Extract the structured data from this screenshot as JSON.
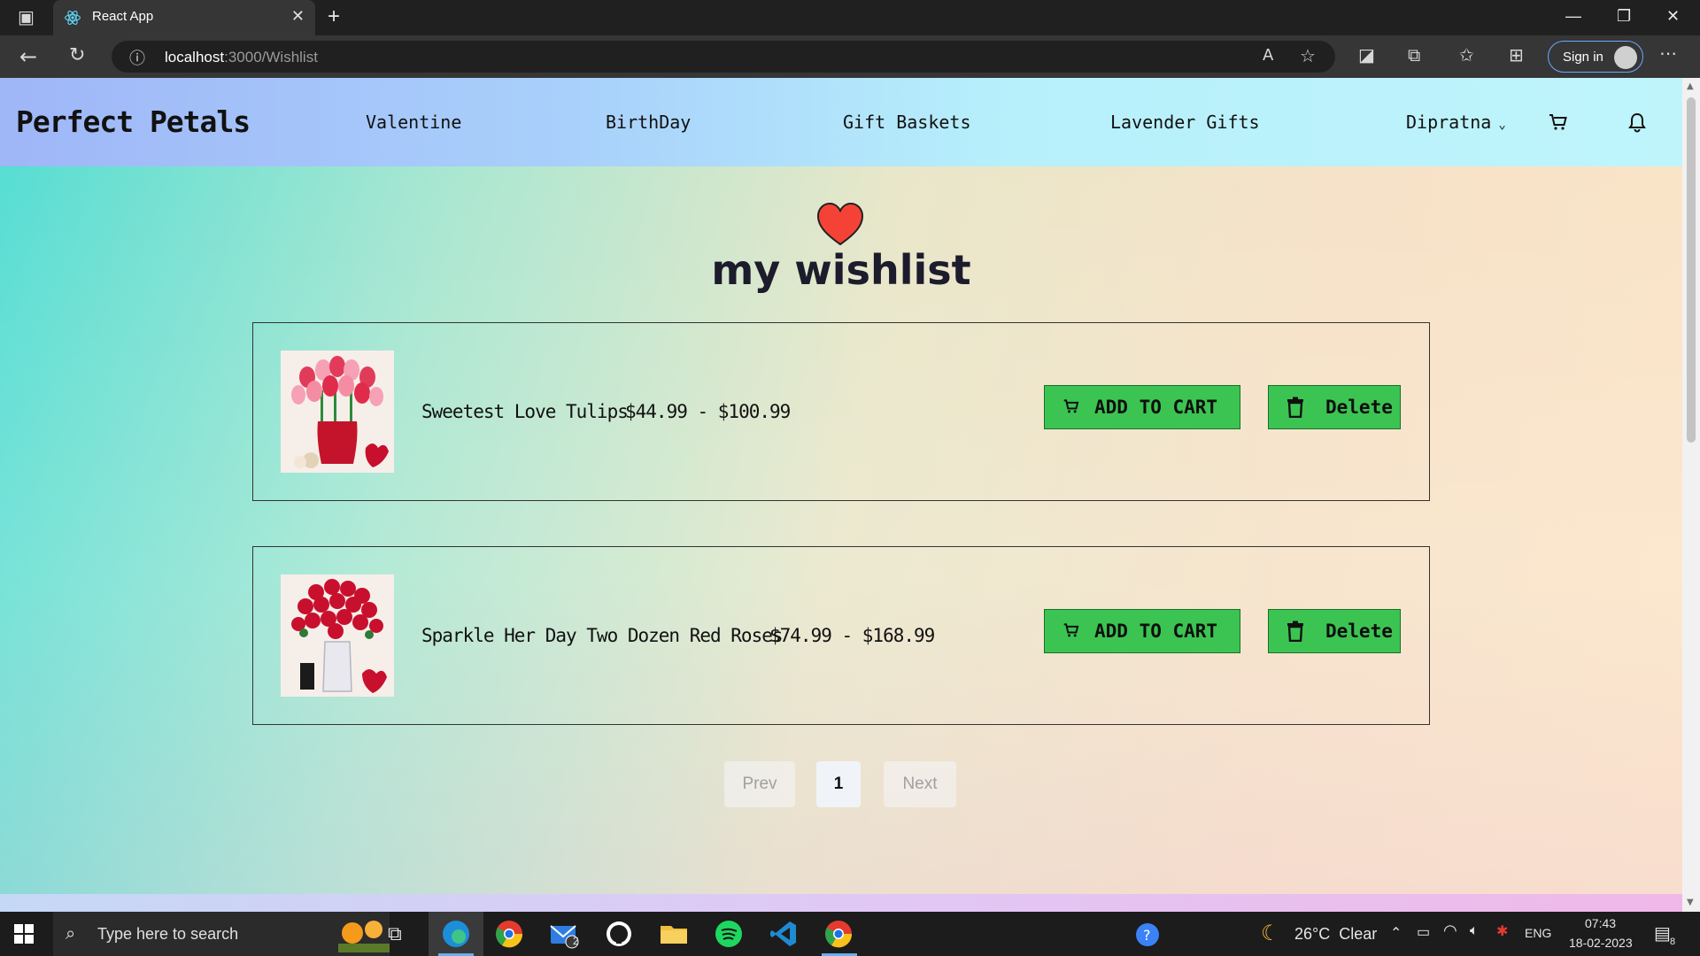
{
  "browser": {
    "tab_title": "React App",
    "url_host": "localhost",
    "url_path": ":3000/Wishlist",
    "sign_in": "Sign in"
  },
  "nav": {
    "brand": "Perfect Petals",
    "links": [
      "Valentine",
      "BirthDay",
      "Gift Baskets",
      "Lavender Gifts"
    ],
    "user": "Dipratna"
  },
  "page": {
    "title": "my wishlist"
  },
  "wishlist": [
    {
      "name": "Sweetest Love Tulips",
      "price": "$44.99 - $100.99",
      "add_label": "ADD TO CART",
      "delete_label": "Delete"
    },
    {
      "name": "Sparkle Her Day Two Dozen Red Roses",
      "price": "$74.99 - $168.99",
      "add_label": "ADD TO CART",
      "delete_label": "Delete"
    }
  ],
  "pagination": {
    "prev": "Prev",
    "current": "1",
    "next": "Next"
  },
  "taskbar": {
    "search_placeholder": "Type here to search",
    "mail_badge": "2",
    "weather": "26°C  Clear",
    "lang": "ENG",
    "time": "07:43",
    "date": "18-02-2023",
    "notif_count": "8"
  },
  "colors": {
    "button_green": "#3cc452",
    "heart_red": "#f44336",
    "accent_blue": "#6aaef0"
  }
}
